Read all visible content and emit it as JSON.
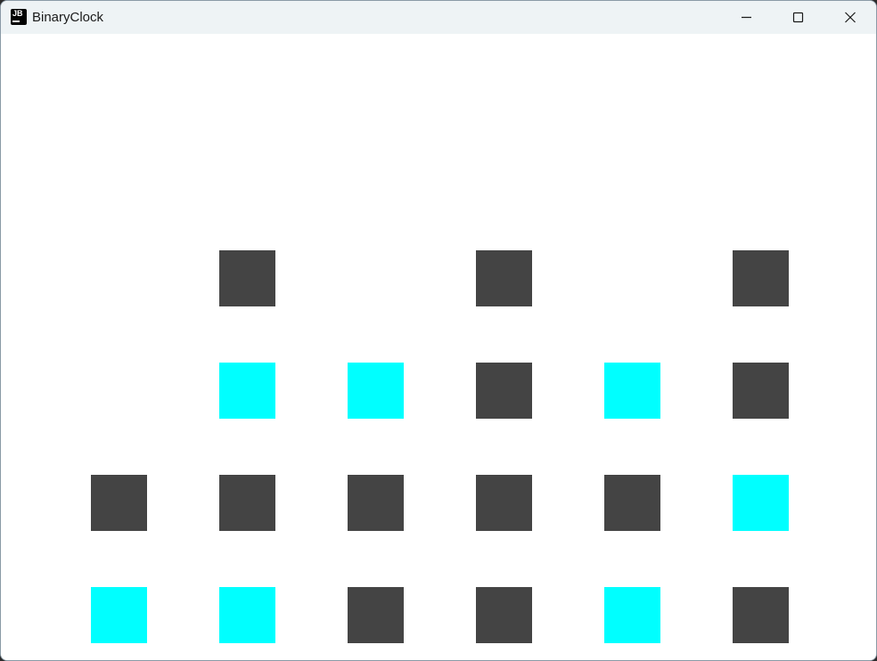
{
  "window": {
    "title": "BinaryClock",
    "app_icon_text": "JB",
    "controls": {
      "minimize_icon": "minimize-icon",
      "maximize_icon": "maximize-icon",
      "close_icon": "close-icon"
    }
  },
  "clock": {
    "colors": {
      "on": "#00ffff",
      "off": "#444444"
    },
    "columns": [
      {
        "bits": [
          null,
          null,
          0,
          1
        ]
      },
      {
        "bits": [
          0,
          1,
          0,
          1
        ]
      },
      {
        "bits": [
          null,
          1,
          0,
          0
        ]
      },
      {
        "bits": [
          0,
          0,
          0,
          0
        ]
      },
      {
        "bits": [
          null,
          1,
          0,
          1
        ]
      },
      {
        "bits": [
          0,
          0,
          1,
          0
        ]
      }
    ]
  }
}
